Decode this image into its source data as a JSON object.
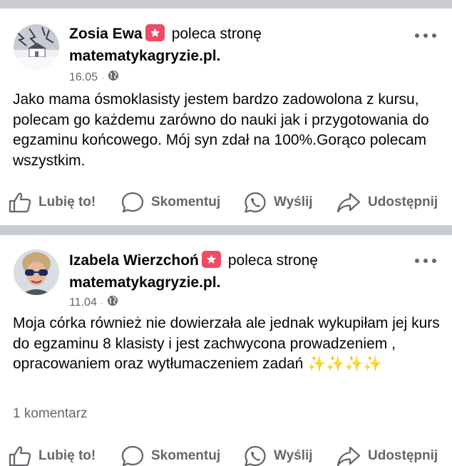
{
  "posts": [
    {
      "author": "Zosia Ewa",
      "action": "poleca stronę",
      "page": "matematykagryzie.pl.",
      "date": "16.05",
      "meta_separator": "·",
      "privacy_icon": "globe-icon",
      "text": "Jako mama ósmoklasisty jestem bardzo zadowolona z kursu, polecam go każdemu  zarówno do nauki jak i przygotowania do egzaminu końcowego. Mój syn zdał na 100%.Gorąco polecam wszystkim.",
      "comments_count": "",
      "actions": {
        "like": "Lubię to!",
        "comment": "Skomentuj",
        "send": "Wyślij",
        "share": "Udostępnij"
      }
    },
    {
      "author": "Izabela Wierzchoń",
      "action": "poleca stronę",
      "page": "matematykagryzie.pl.",
      "date": "11.04",
      "meta_separator": "·",
      "privacy_icon": "globe-icon",
      "text": "Moja córka również nie dowierzała ale jednak wykupiłam jej kurs do egzaminu 8 klasisty i jest zachwycona prowadzeniem , opracowaniem oraz wytłumaczeniem zadań ✨✨✨✨",
      "comments_count": "1 komentarz",
      "actions": {
        "like": "Lubię to!",
        "comment": "Skomentuj",
        "send": "Wyślij",
        "share": "Udostępnij"
      }
    }
  ],
  "colors": {
    "separator": "#c9ccd1",
    "secondary_text": "#65676b",
    "recommend_badge": "#f04b63",
    "primary_text": "#050505"
  }
}
